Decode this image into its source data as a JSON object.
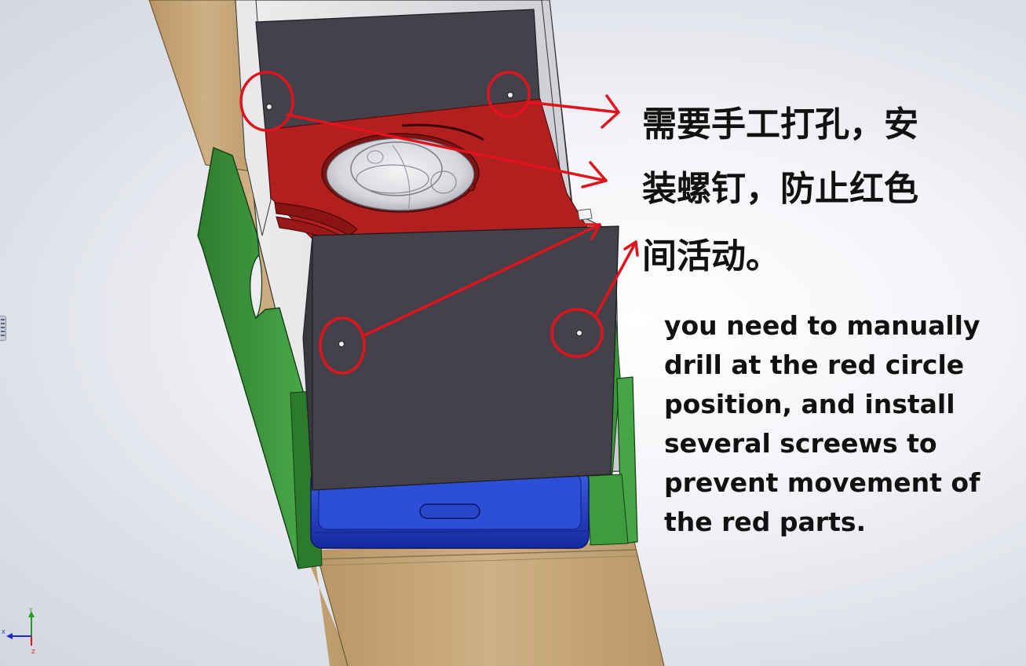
{
  "annotation": {
    "zh_lines": [
      "需要手工打孔，安",
      "装螺钉，防止红色",
      "间活动。"
    ],
    "en_lines": [
      "you need to manually",
      "drill at the red circle",
      "position, and install",
      "several screews to",
      "prevent movement of",
      "the red parts."
    ]
  },
  "triad_axes": {
    "y": "Y",
    "x": "X",
    "z": "Z"
  },
  "colors": {
    "cardboard": "#c8a878",
    "green_panel": "#3e9a3e",
    "red_part": "#b0201e",
    "dark_panel": "#44414a",
    "blue_phone": "#1f3fc8",
    "markup_red": "#e0141c"
  },
  "icons": {
    "left_tab": "panel-expander-icon",
    "triad": "reference-triad-icon"
  }
}
